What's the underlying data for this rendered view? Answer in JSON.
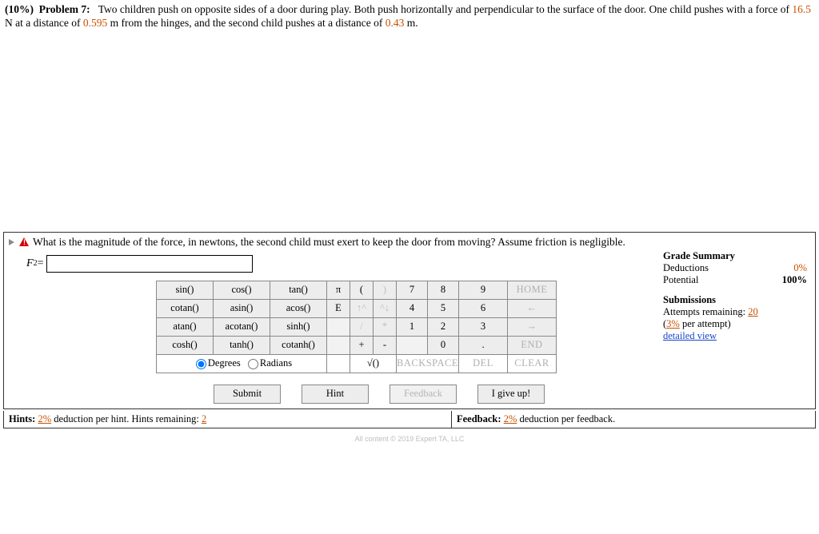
{
  "problem": {
    "weight": "(10%)",
    "label": "Problem 7:",
    "text_1": "Two children push on opposite sides of a door during play. Both push horizontally and perpendicular to the surface of the door. One child pushes with a force of ",
    "force": "16.5",
    "text_2": " N at a distance of ",
    "dist1": "0.595",
    "text_3": " m from the hinges, and the second child pushes at a distance of ",
    "dist2": "0.43",
    "text_4": " m."
  },
  "question": "What is the magnitude of the force, in newtons, the second child must exert to keep the door from moving? Assume friction is negligible.",
  "answer": {
    "var": "F",
    "sub": "2",
    "eq": " = ",
    "value": ""
  },
  "keypad": {
    "fns": [
      [
        "sin()",
        "cos()",
        "tan()"
      ],
      [
        "cotan()",
        "asin()",
        "acos()"
      ],
      [
        "atan()",
        "acotan()",
        "sinh()"
      ],
      [
        "cosh()",
        "tanh()",
        "cotanh()"
      ]
    ],
    "syms": [
      [
        "π",
        "(",
        ")"
      ],
      [
        "E",
        "↑^",
        "^↓"
      ],
      [
        "",
        "/",
        "*"
      ],
      [
        "",
        "+",
        "-"
      ]
    ],
    "nums": [
      [
        "7",
        "8",
        "9"
      ],
      [
        "4",
        "5",
        "6"
      ],
      [
        "1",
        "2",
        "3"
      ],
      [
        "",
        "0",
        "."
      ]
    ],
    "side": [
      "HOME",
      "←",
      "→",
      "END"
    ],
    "bottom": [
      "√()",
      "BACKSPACE",
      "DEL",
      "CLEAR"
    ],
    "modes": {
      "deg": "Degrees",
      "rad": "Radians"
    }
  },
  "actions": {
    "submit": "Submit",
    "hint": "Hint",
    "feedback": "Feedback",
    "giveup": "I give up!"
  },
  "summary": {
    "title": "Grade Summary",
    "deductions_label": "Deductions",
    "deductions_value": "0%",
    "potential_label": "Potential",
    "potential_value": "100%",
    "subs_title": "Submissions",
    "attempts_label": "Attempts remaining: ",
    "attempts_value": "20",
    "per_attempt_label": " per attempt)",
    "per_attempt_value": "3%",
    "detailed": "detailed view"
  },
  "hints": {
    "label": "Hints:",
    "value": "2%",
    "tail": " deduction per hint. Hints remaining: ",
    "remaining": "2"
  },
  "feedback": {
    "label": "Feedback:",
    "value": "2%",
    "tail": " deduction per feedback."
  },
  "footer": "All content © 2019 Expert TA, LLC"
}
